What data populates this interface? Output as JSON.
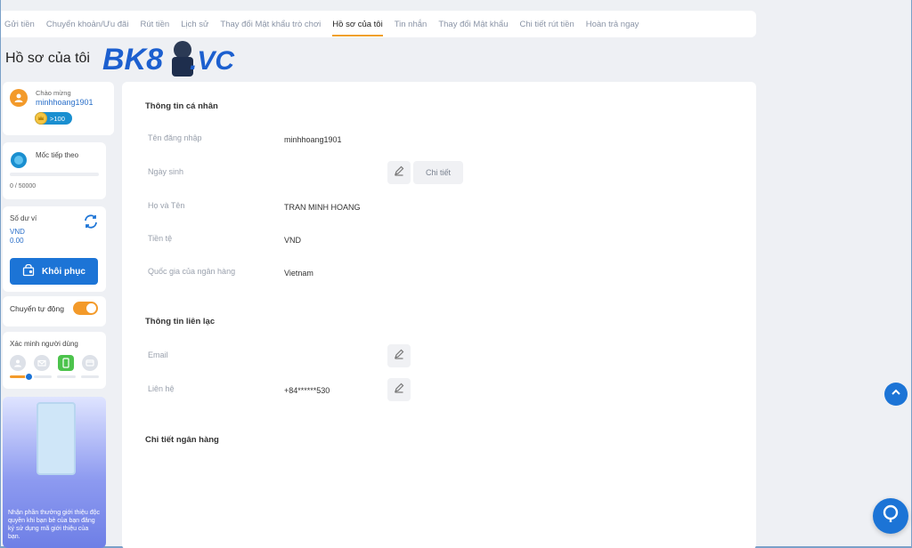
{
  "nav": {
    "tabs": [
      {
        "label": "Gửi tiền"
      },
      {
        "label": "Chuyển khoản/Ưu đãi"
      },
      {
        "label": "Rút tiền"
      },
      {
        "label": "Lịch sử"
      },
      {
        "label": "Thay đổi Mật khẩu trò chơi"
      },
      {
        "label": "Hồ sơ của tôi"
      },
      {
        "label": "Tin nhắn"
      },
      {
        "label": "Thay đổi Mật khẩu"
      },
      {
        "label": "Chi tiết rút tiền"
      },
      {
        "label": "Hoàn trả ngay"
      }
    ],
    "active_index": 5
  },
  "page": {
    "title": "Hồ sơ của tôi"
  },
  "logo": {
    "text": "BK8.VC",
    "accent": "#1c5fcf"
  },
  "sidebar": {
    "greeting": "Chào mừng",
    "username": "minhhoang1901",
    "level_badge": ">100",
    "milestone_label": "Mốc tiếp theo",
    "milestone_value": "0 / 50000",
    "milestone_progress": 0,
    "balance_label": "Số dư ví",
    "balance_currency": "VND",
    "balance_value": "0.00",
    "restore_button": "Khôi phục",
    "auto_transfer_label": "Chuyển tự động",
    "auto_transfer_on": true,
    "verify_label": "Xác minh người dùng",
    "verify_icons": [
      "user-icon",
      "email-icon",
      "phone-icon",
      "bank-card-icon"
    ],
    "promo_text": "Nhận phần thưởng giới thiệu độc quyền khi bạn bè của bạn đăng ký sử dụng mã giới thiệu của bạn."
  },
  "profile": {
    "personal_title": "Thông tin cá nhân",
    "fields": [
      {
        "label": "Tên đăng nhập",
        "value": "minhhoang1901"
      },
      {
        "label": "Ngày sinh",
        "value": ""
      },
      {
        "label": "Họ và Tên",
        "value": "TRAN MINH HOANG"
      },
      {
        "label": "Tiền tệ",
        "value": "VND"
      },
      {
        "label": "Quốc gia của ngân hàng",
        "value": "Vietnam"
      }
    ],
    "detail_button": "Chi tiết",
    "contact_title": "Thông tin liên lạc",
    "contact": [
      {
        "label": "Email",
        "value": ""
      },
      {
        "label": "Liên hệ",
        "value": "+84******530"
      }
    ],
    "bank_title": "Chi tiết ngân hàng"
  },
  "colors": {
    "accent": "#1c74d6",
    "orange": "#f39a2a"
  }
}
